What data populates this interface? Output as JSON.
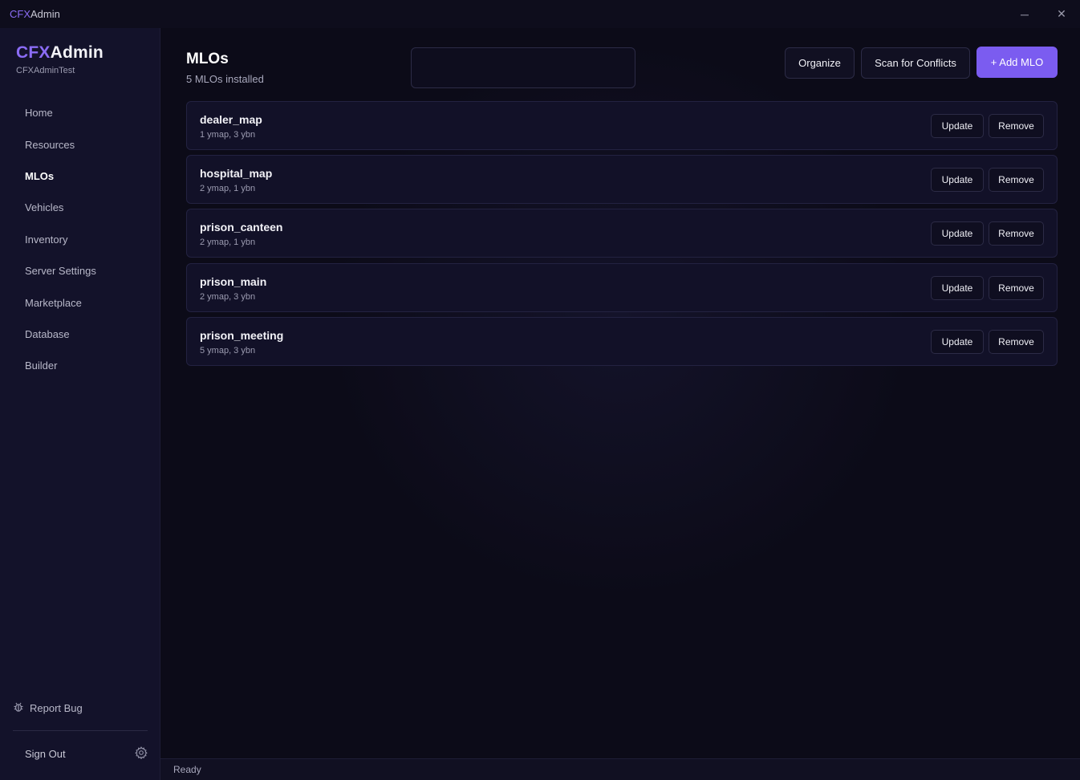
{
  "window": {
    "title_cfx": "CFX",
    "title_admin": "Admin",
    "minimize_glyph": "─",
    "close_glyph": "✕"
  },
  "brand": {
    "logo_cfx": "CFX",
    "logo_admin": "Admin",
    "server_name": "CFXAdminTest",
    "accent_color": "#8b6cf5"
  },
  "sidebar": {
    "items": [
      {
        "label": "Home"
      },
      {
        "label": "Resources"
      },
      {
        "label": "MLOs",
        "active": true
      },
      {
        "label": "Vehicles"
      },
      {
        "label": "Inventory"
      },
      {
        "label": "Server Settings"
      },
      {
        "label": "Marketplace"
      },
      {
        "label": "Database"
      },
      {
        "label": "Builder"
      }
    ],
    "report_bug_label": "Report Bug",
    "sign_out_label": "Sign Out"
  },
  "page": {
    "title": "MLOs",
    "subtitle": "5 MLOs installed",
    "search_value": "",
    "organize_label": "Organize",
    "scan_label": "Scan for Conflicts",
    "add_label": "+ Add MLO"
  },
  "mlos": [
    {
      "name": "dealer_map",
      "meta": "1 ymap, 3 ybn",
      "update_label": "Update",
      "remove_label": "Remove"
    },
    {
      "name": "hospital_map",
      "meta": "2 ymap, 1 ybn",
      "update_label": "Update",
      "remove_label": "Remove"
    },
    {
      "name": "prison_canteen",
      "meta": "2 ymap, 1 ybn",
      "update_label": "Update",
      "remove_label": "Remove"
    },
    {
      "name": "prison_main",
      "meta": "2 ymap, 3 ybn",
      "update_label": "Update",
      "remove_label": "Remove"
    },
    {
      "name": "prison_meeting",
      "meta": "5 ymap, 3 ybn",
      "update_label": "Update",
      "remove_label": "Remove"
    }
  ],
  "status": {
    "text": "Ready"
  }
}
